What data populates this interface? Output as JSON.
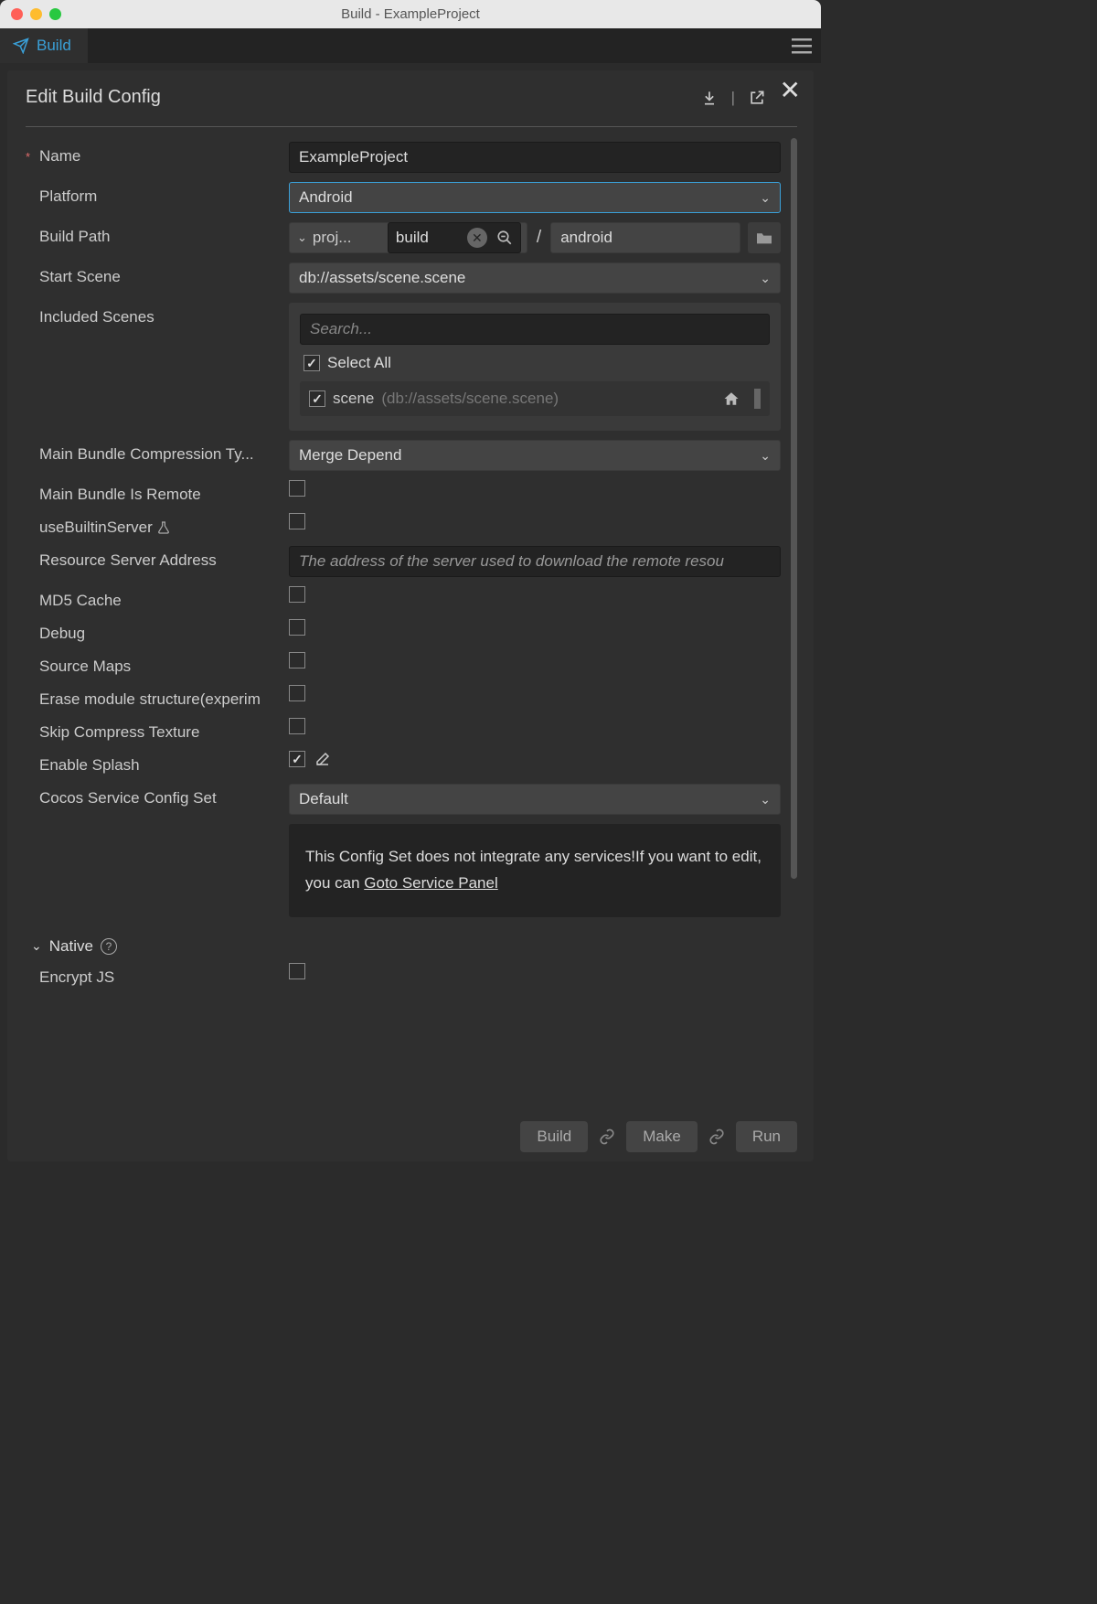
{
  "window": {
    "title": "Build - ExampleProject"
  },
  "tab": {
    "label": "Build"
  },
  "panel": {
    "title": "Edit Build Config"
  },
  "form": {
    "name": {
      "label": "Name",
      "value": "ExampleProject"
    },
    "platform": {
      "label": "Platform",
      "value": "Android"
    },
    "buildPath": {
      "label": "Build Path",
      "prefix": "proj...",
      "dir": "build",
      "sub": "android"
    },
    "startScene": {
      "label": "Start Scene",
      "value": "db://assets/scene.scene"
    },
    "includedScenes": {
      "label": "Included Scenes",
      "searchPlaceholder": "Search...",
      "selectAll": "Select All",
      "items": [
        {
          "name": "scene",
          "path": "(db://assets/scene.scene)",
          "checked": true
        }
      ]
    },
    "compressionType": {
      "label": "Main Bundle Compression Ty...",
      "value": "Merge Depend"
    },
    "mainBundleRemote": {
      "label": "Main Bundle Is Remote"
    },
    "useBuiltinServer": {
      "label": "useBuiltinServer"
    },
    "resourceServer": {
      "label": "Resource Server Address",
      "placeholder": "The address of the server used to download the remote resou"
    },
    "md5": {
      "label": "MD5 Cache"
    },
    "debug": {
      "label": "Debug"
    },
    "sourceMaps": {
      "label": "Source Maps"
    },
    "eraseModule": {
      "label": "Erase module structure(experim"
    },
    "skipCompress": {
      "label": "Skip Compress Texture"
    },
    "enableSplash": {
      "label": "Enable Splash"
    },
    "cocosService": {
      "label": "Cocos Service Config Set",
      "value": "Default"
    },
    "notice": {
      "text1": "This Config Set does not integrate any services!If you want to edit, you can ",
      "link": "Goto Service Panel"
    },
    "native": {
      "label": "Native"
    },
    "encryptJs": {
      "label": "Encrypt JS"
    }
  },
  "footer": {
    "build": "Build",
    "make": "Make",
    "run": "Run"
  }
}
